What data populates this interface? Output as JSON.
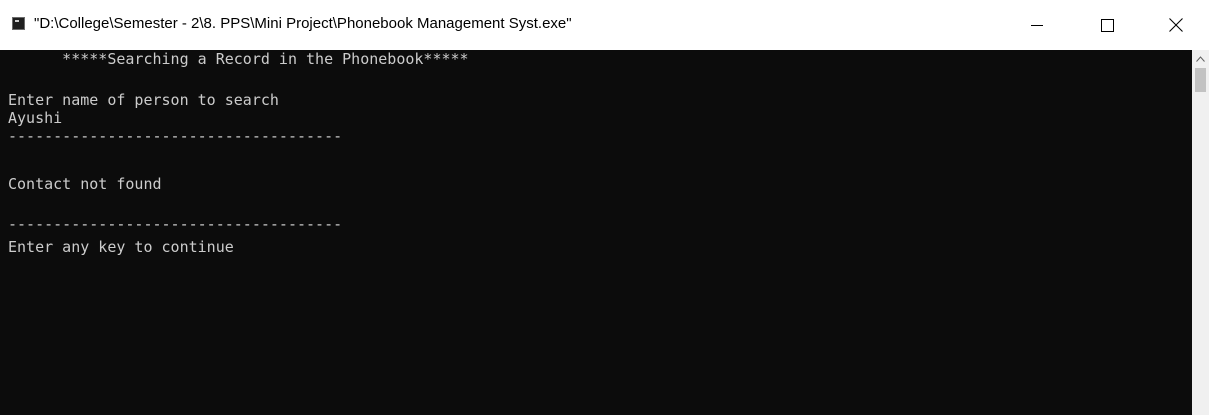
{
  "window": {
    "title": "\"D:\\College\\Semester - 2\\8. PPS\\Mini Project\\Phonebook Management Syst.exe\"",
    "icon": "console-app-icon",
    "controls": {
      "minimize_icon": "minimize-icon",
      "maximize_icon": "maximize-icon",
      "close_icon": "close-icon"
    }
  },
  "console": {
    "background_color": "#0c0c0c",
    "text_color": "#cccccc",
    "lines": [
      "      *****Searching a Record in the Phonebook*****",
      "",
      "Enter name of person to search",
      "Ayushi",
      "-------------------------------------",
      "",
      "Contact not found",
      "",
      "-------------------------------------",
      "Enter any key to continue"
    ]
  },
  "scrollbar": {
    "up_icon": "chevron-up-icon"
  }
}
